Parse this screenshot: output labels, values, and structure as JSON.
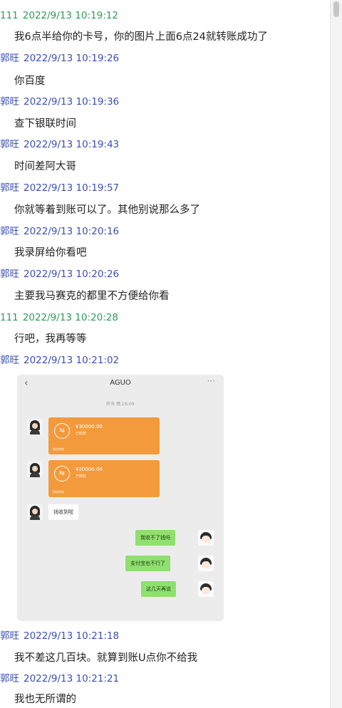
{
  "messages": [
    {
      "sender": "111",
      "time": "2022/9/13 10:19:12",
      "text": "我6点半给你的卡号，你的图片上面6点24就转账成功了",
      "side": "self"
    },
    {
      "sender": "郭旺",
      "time": "2022/9/13 10:19:26",
      "text": "你百度",
      "side": "other"
    },
    {
      "sender": "郭旺",
      "time": "2022/9/13 10:19:36",
      "text": "查下银联时间",
      "side": "other"
    },
    {
      "sender": "郭旺",
      "time": "2022/9/13 10:19:43",
      "text": "时间差阿大哥",
      "side": "other"
    },
    {
      "sender": "郭旺",
      "time": "2022/9/13 10:19:57",
      "text": "你就等着到账可以了。其他别说那么多了",
      "side": "other"
    },
    {
      "sender": "郭旺",
      "time": "2022/9/13 10:20:16",
      "text": "我录屏给你看吧",
      "side": "other"
    },
    {
      "sender": "郭旺",
      "time": "2022/9/13 10:20:26",
      "text": "主要我马赛克的都里不方便给你看",
      "side": "other"
    },
    {
      "sender": "111",
      "time": "2022/9/13 10:20:28",
      "text": "行吧，我再等等",
      "side": "self"
    },
    {
      "sender": "郭旺",
      "time": "2022/9/13 10:21:02",
      "text": "",
      "side": "other"
    },
    {
      "sender": "郭旺",
      "time": "2022/9/13 10:21:18",
      "text": "我不差这几百块。就算到账U点你不给我",
      "side": "other"
    },
    {
      "sender": "郭旺",
      "time": "2022/9/13 10:21:21",
      "text": "我也无所谓的",
      "side": "other"
    }
  ],
  "screenshot": {
    "back_glyph": "‹",
    "title": "AGUO",
    "more_glyph": "···",
    "timestamp": "昨天 晚上6:09",
    "transfers": [
      {
        "amount": "¥30000.00",
        "sub": "已收款",
        "foot": "微信转账"
      },
      {
        "amount": "¥20000.00",
        "sub": "已收款",
        "foot": "微信转账"
      }
    ],
    "left_bubble": "钱收到啦",
    "right_bubbles": [
      "我收不了钱吗",
      "支付宝也不行了",
      "这几天再说"
    ]
  },
  "icons": {
    "avatar": "avatar-icon",
    "transfer": "transfer-icon"
  },
  "colors": {
    "self_header": "#2f9a5a",
    "other_header": "#3a4fb2",
    "transfer_card": "#f39a3c",
    "green_bubble": "#8fe06e"
  }
}
